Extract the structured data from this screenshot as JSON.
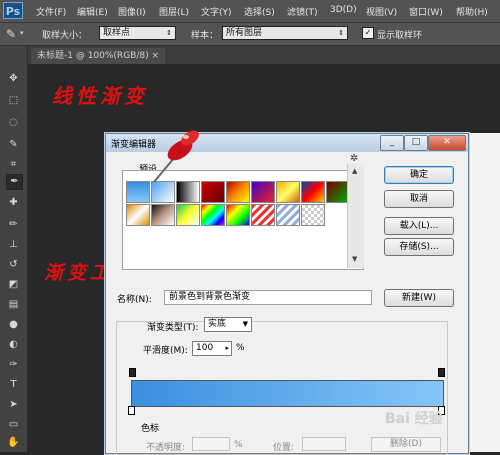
{
  "app": {
    "logo": "Ps"
  },
  "menu": [
    "文件(F)",
    "编辑(E)",
    "图像(I)",
    "图层(L)",
    "文字(Y)",
    "选择(S)",
    "滤镜(T)",
    "3D(D)",
    "视图(V)",
    "窗口(W)",
    "帮助(H)"
  ],
  "options": {
    "sample_size_label": "取样大小：",
    "sample_size_value": "取样点",
    "sample_label": "样本：",
    "sample_value": "所有图层",
    "show_ring_label": "显示取样环"
  },
  "document_tab": "未标题-1 @ 100%(RGB/8)",
  "annotations": {
    "linear": "线性渐变",
    "tool": "渐变工具"
  },
  "dialog": {
    "title": "渐变编辑器",
    "presets_label": "预设",
    "ok": "确定",
    "cancel": "取消",
    "load": "载入(L)...",
    "save": "存储(S)...",
    "name_label": "名称(N):",
    "name_value": "前景色到背景色渐变",
    "new_button": "新建(W)",
    "type_label": "渐变类型(T):",
    "type_value": "实底",
    "smooth_label": "平滑度(M):",
    "smooth_value": "100",
    "smooth_unit": "%",
    "stops_label": "色标",
    "opacity_label": "不透明度:",
    "opacity_unit": "%",
    "location_label": "位置:",
    "delete_button": "删除(D)"
  },
  "colors": {
    "accent_red": "#e01010",
    "gradient_start": "#3a8fe0",
    "gradient_end": "#86c6f8"
  },
  "watermark": "Bai 经验"
}
